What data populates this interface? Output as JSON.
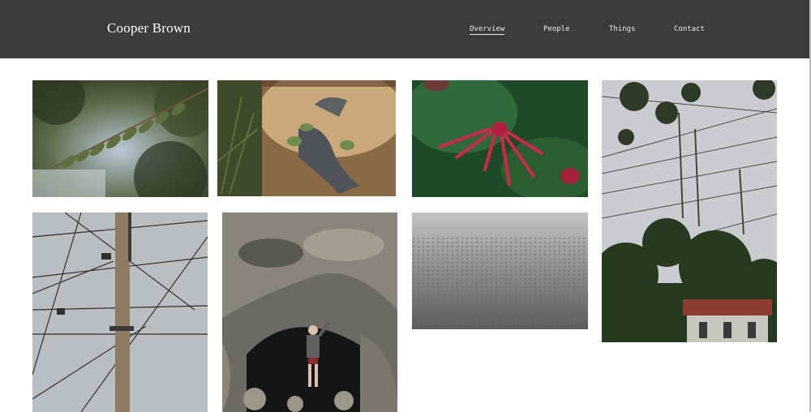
{
  "site": {
    "title": "Cooper Brown"
  },
  "nav": {
    "items": [
      {
        "label": "Overview",
        "active": true
      },
      {
        "label": "People",
        "active": false
      },
      {
        "label": "Things",
        "active": false
      },
      {
        "label": "Contact",
        "active": false
      }
    ]
  },
  "colors": {
    "header_bg": "#3b3b3b",
    "page_bg": "#ffffff",
    "nav_text": "#ececec"
  },
  "gallery": {
    "photos": [
      {
        "icon": "leaf-branch-photo"
      },
      {
        "icon": "plant-glove-photo"
      },
      {
        "icon": "red-flower-photo"
      },
      {
        "icon": "tree-wires-photo"
      },
      {
        "icon": "utility-pole-photo"
      },
      {
        "icon": "cave-figure-photo"
      },
      {
        "icon": "textured-surface-photo"
      }
    ]
  }
}
